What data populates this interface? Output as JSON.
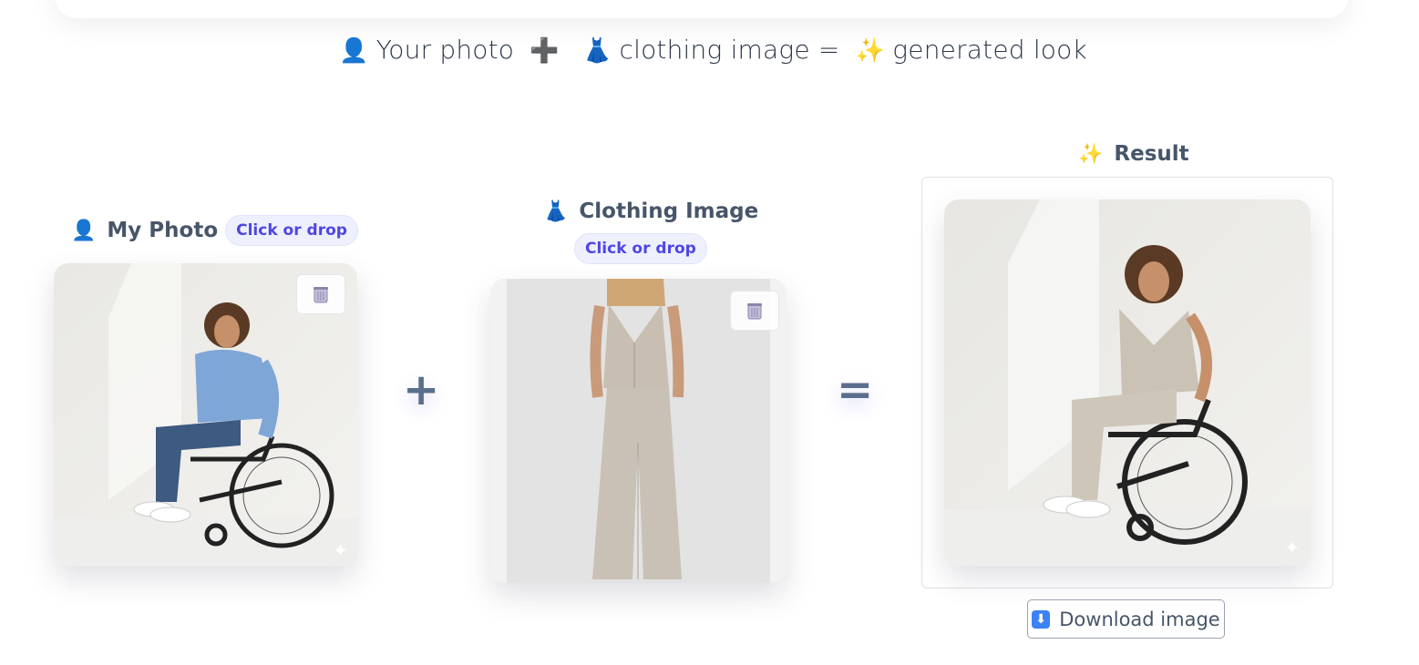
{
  "header": {
    "tagline": {
      "person_emoji": "👤",
      "part1": "Your photo",
      "plus_emoji": "➕",
      "dress_emoji": "👗",
      "part2": "clothing image =",
      "sparkle_emoji": "✨",
      "part3": "generated look"
    }
  },
  "my_photo": {
    "label": "My Photo",
    "emoji": "👤",
    "upload_label": "Click or drop"
  },
  "clothing": {
    "label": "Clothing Image",
    "emoji": "👗",
    "upload_label": "Click or drop"
  },
  "operators": {
    "plus": "+",
    "equals": "="
  },
  "result": {
    "label": "Result",
    "emoji": "✨",
    "download_label": "Download image",
    "download_icon": "⬇"
  },
  "icons": {
    "delete": "trash-icon",
    "watermark": "sparkle-icon"
  },
  "colors": {
    "accent": "#4f46e5",
    "pill_bg": "#eef0fd",
    "operator": "#5b6f8c"
  }
}
